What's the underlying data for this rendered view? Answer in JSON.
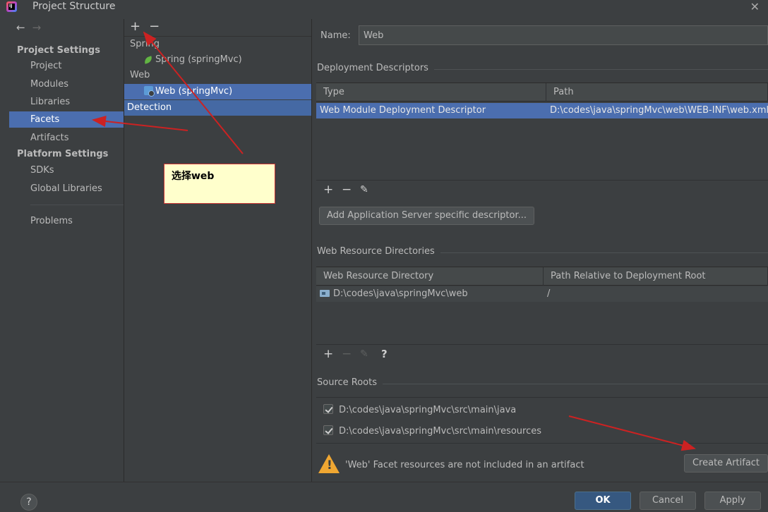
{
  "window": {
    "title": "Project Structure",
    "close_glyph": "✕",
    "app_icon_label": "IJ"
  },
  "nav": {
    "back_glyph": "←",
    "forward_glyph": "→",
    "project_settings_header": "Project Settings",
    "platform_settings_header": "Platform Settings",
    "items": [
      {
        "label": "Project",
        "selected": false
      },
      {
        "label": "Modules",
        "selected": false
      },
      {
        "label": "Libraries",
        "selected": false
      },
      {
        "label": "Facets",
        "selected": true
      },
      {
        "label": "Artifacts",
        "selected": false
      },
      {
        "label": "SDKs",
        "selected": false
      },
      {
        "label": "Global Libraries",
        "selected": false
      },
      {
        "label": "Problems",
        "selected": false
      }
    ]
  },
  "tree": {
    "add_glyph": "+",
    "remove_glyph": "−",
    "rows": [
      {
        "label": "Spring",
        "icon": null
      },
      {
        "label": "Spring (springMvc)",
        "icon": "spring-leaf-icon"
      },
      {
        "label": "Web",
        "icon": null
      },
      {
        "label": "Web (springMvc)",
        "icon": "web-facet-icon",
        "selected": true
      },
      {
        "label": "Detection",
        "icon": null,
        "selected": true
      }
    ]
  },
  "detail": {
    "name_label": "Name:",
    "name_value": "Web",
    "deployment": {
      "title": "Deployment Descriptors",
      "col_type": "Type",
      "col_path": "Path",
      "rows": [
        {
          "type": "Web Module Deployment Descriptor",
          "path": "D:\\codes\\java\\springMvc\\web\\WEB-INF\\web.xml"
        }
      ],
      "add_server_button": "Add Application Server specific descriptor..."
    },
    "web_resources": {
      "title": "Web Resource Directories",
      "col_dir": "Web Resource Directory",
      "col_rel": "Path Relative to Deployment Root",
      "rows": [
        {
          "dir": "D:\\codes\\java\\springMvc\\web",
          "rel": "/"
        }
      ],
      "help_glyph": "?"
    },
    "source_roots": {
      "title": "Source Roots",
      "items": [
        {
          "path": "D:\\codes\\java\\springMvc\\src\\main\\java",
          "checked": true
        },
        {
          "path": "D:\\codes\\java\\springMvc\\src\\main\\resources",
          "checked": true
        }
      ]
    },
    "warning_text": "'Web' Facet resources are not included in an artifact",
    "create_artifact_button": "Create Artifact"
  },
  "footer": {
    "help_glyph": "?",
    "ok": "OK",
    "cancel": "Cancel",
    "apply": "Apply"
  },
  "annotation": {
    "text": "选择web",
    "arrow_color": "#cc2222"
  },
  "colors": {
    "background": "#3c3f41",
    "selection": "#4b6eaf",
    "primary_button": "#365880",
    "warning": "#f0a732"
  }
}
